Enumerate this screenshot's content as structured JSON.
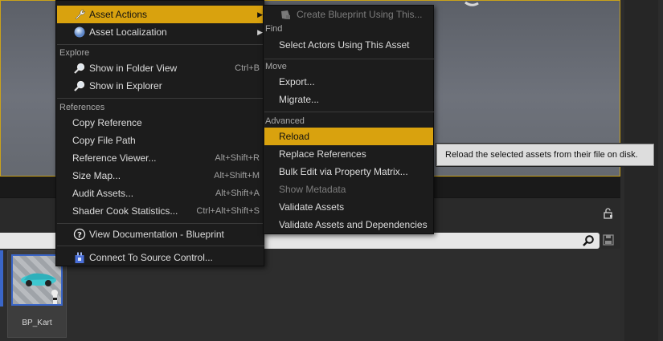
{
  "main_menu": {
    "asset_actions": "Asset Actions",
    "asset_localization": "Asset Localization",
    "explore_header": "Explore",
    "show_folder": {
      "label": "Show in Folder View",
      "shortcut": "Ctrl+B"
    },
    "show_explorer": "Show in Explorer",
    "references_header": "References",
    "copy_reference": "Copy Reference",
    "copy_file_path": "Copy File Path",
    "reference_viewer": {
      "label": "Reference Viewer...",
      "shortcut": "Alt+Shift+R"
    },
    "size_map": {
      "label": "Size Map...",
      "shortcut": "Alt+Shift+M"
    },
    "audit_assets": {
      "label": "Audit Assets...",
      "shortcut": "Alt+Shift+A"
    },
    "shader_cook": {
      "label": "Shader Cook Statistics...",
      "shortcut": "Ctrl+Alt+Shift+S"
    },
    "view_documentation": "View Documentation - Blueprint",
    "connect_source_control": "Connect To Source Control..."
  },
  "sub_menu": {
    "create_blueprint": "Create Blueprint Using This...",
    "find_header": "Find",
    "select_actors": "Select Actors Using This Asset",
    "move_header": "Move",
    "export": "Export...",
    "migrate": "Migrate...",
    "advanced_header": "Advanced",
    "reload": "Reload",
    "replace_references": "Replace References",
    "bulk_edit": "Bulk Edit via Property Matrix...",
    "show_metadata": "Show Metadata",
    "validate_assets": "Validate Assets",
    "validate_assets_deps": "Validate Assets and Dependencies"
  },
  "tooltip": "Reload the selected assets from their file on disk.",
  "asset": {
    "name": "BP_Kart"
  },
  "colors": {
    "highlight": "#d9a20e",
    "selection_border": "#3a66c8",
    "viewport_border": "#caa21a"
  },
  "icons": [
    "wrench-icon",
    "globe-icon",
    "magnifier-icon",
    "help-icon",
    "source-control-icon",
    "blueprint-icon",
    "lock-icon",
    "search-icon",
    "save-icon"
  ]
}
